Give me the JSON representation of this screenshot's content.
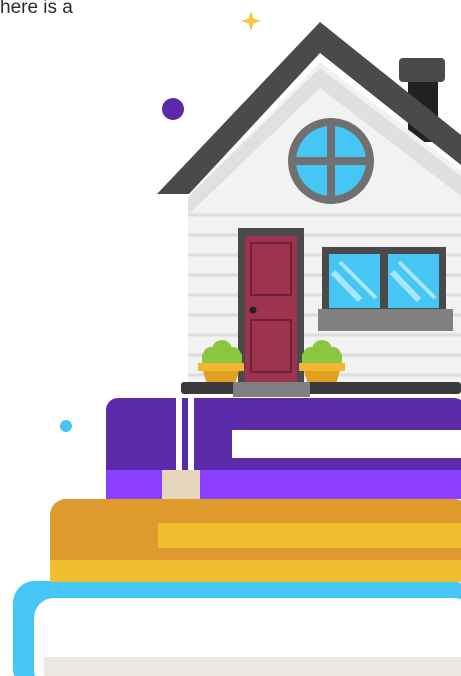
{
  "caption": {
    "text": "here is a"
  },
  "illustration": {
    "subject": "house-on-stacked-books",
    "icons": [
      "sparkle-icon",
      "dot-icon",
      "house-icon",
      "book-stack-icon"
    ],
    "colors": {
      "roof": "#4a4a4a",
      "siding": "#f2f2f2",
      "siding_line": "#dcdcdc",
      "window_glass": "#45c6f5",
      "window_frame": "#707070",
      "door": "#9e3350",
      "plant_pot": "#f2b630",
      "plant_leaves": "#8cc63f",
      "book_top": "#5b2aa8",
      "book_top_edge": "#8c3fff",
      "book_middle": "#de9a2c",
      "book_middle_band": "#f0be2f",
      "book_bottom": "#45c6f5",
      "pages": "#ffffff",
      "pages_shadow": "#eee8e2",
      "bookmark": "#e6d6bc",
      "sparkle": "#f5c842",
      "dot_purple": "#5b2aa8",
      "dot_blue": "#45c6f5"
    }
  }
}
